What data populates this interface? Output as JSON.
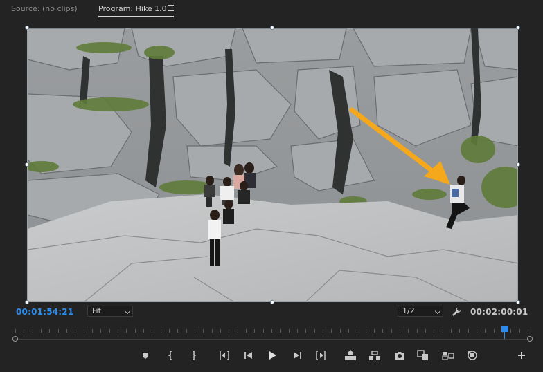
{
  "tabs": {
    "source": "Source: (no clips)",
    "program": "Program: Hike 1.0"
  },
  "timecode": {
    "current": "00:01:54:21",
    "total": "00:02:00:01"
  },
  "zoom": {
    "selected": "Fit"
  },
  "resolution": {
    "selected": "1/2"
  },
  "playback": {
    "position_fraction": 0.955
  },
  "colors": {
    "accent": "#2d8ceb",
    "arrow": "#f5a81c",
    "panel": "#232323"
  },
  "icons": {
    "transport": [
      "add-marker-icon",
      "mark-in-icon",
      "mark-out-icon",
      "go-to-in-icon",
      "step-back-icon",
      "play-icon",
      "step-forward-icon",
      "go-to-out-icon",
      "lift-icon",
      "extract-icon",
      "export-frame-icon",
      "comparison-view-icon",
      "multi-camera-icon",
      "vr-video-icon",
      "add-button-icon"
    ]
  }
}
